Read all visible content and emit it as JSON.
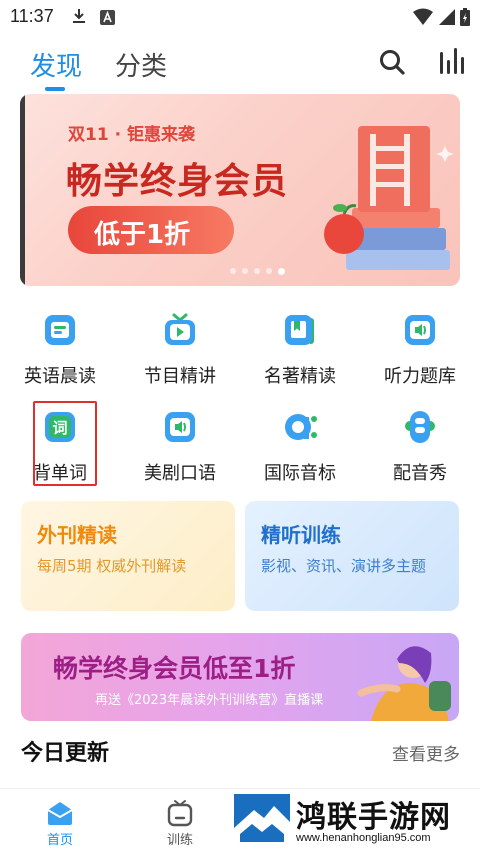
{
  "status_bar": {
    "time": "11:37",
    "icons": [
      "download-icon",
      "a-notification-icon",
      "wifi-icon",
      "signal-icon",
      "battery-icon"
    ]
  },
  "header": {
    "tabs": [
      {
        "label": "发现",
        "active": true
      },
      {
        "label": "分类",
        "active": false
      }
    ],
    "icons": [
      "search-icon",
      "stats-icon"
    ]
  },
  "banner": {
    "tag": "双11 · 钜惠来袭",
    "title": "畅学终身会员",
    "pill": "低于1折",
    "page_count": 5,
    "active_page": 5
  },
  "features": [
    {
      "label": "英语晨读",
      "icon": "morning-reading-icon"
    },
    {
      "label": "节目精讲",
      "icon": "program-icon"
    },
    {
      "label": "名著精读",
      "icon": "classics-icon"
    },
    {
      "label": "听力题库",
      "icon": "listening-icon"
    },
    {
      "label": "背单词",
      "icon": "vocabulary-icon",
      "glyph": "词"
    },
    {
      "label": "美剧口语",
      "icon": "tv-speaking-icon"
    },
    {
      "label": "国际音标",
      "icon": "phonetics-icon"
    },
    {
      "label": "配音秀",
      "icon": "dubbing-icon"
    }
  ],
  "cards": {
    "left": {
      "title": "外刊精读",
      "subtitle": "每周5期 权威外刊解读"
    },
    "right": {
      "title": "精听训练",
      "subtitle": "影视、资讯、演讲多主题"
    }
  },
  "promo": {
    "title": "畅学终身会员低至1折",
    "subtitle": "再送《2023年晨读外刊训练营》直播课"
  },
  "section": {
    "title": "今日更新",
    "see_more": "查看更多"
  },
  "bottom_nav": {
    "items": [
      {
        "label": "首页",
        "active": true
      },
      {
        "label": "训练",
        "active": false
      }
    ]
  },
  "watermark": {
    "title": "鸿联手游网",
    "url": "www.henanhonglian95.com"
  },
  "colors": {
    "accent": "#1e8ee6",
    "icon_blue": "#3aa0f0",
    "icon_green": "#2fb86a",
    "banner_red": "#c8281f",
    "highlight_red": "#e0302a"
  }
}
